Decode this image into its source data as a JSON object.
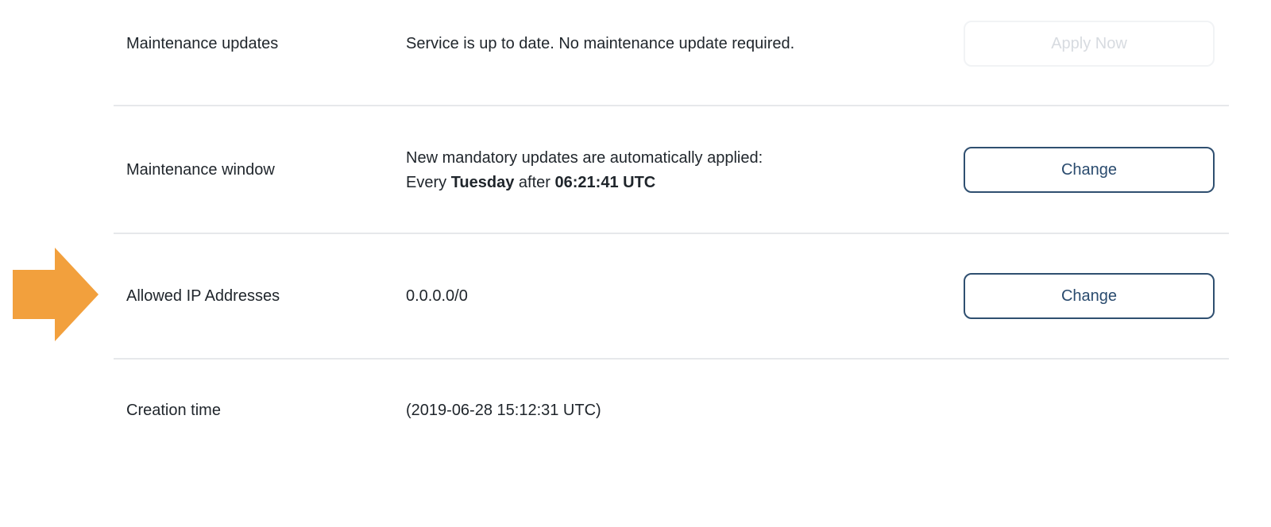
{
  "settings": {
    "maintenance_updates": {
      "label": "Maintenance updates",
      "value": "Service is up to date. No maintenance update required.",
      "button_label": "Apply Now",
      "button_enabled": false
    },
    "maintenance_window": {
      "label": "Maintenance window",
      "value_line1": "New mandatory updates are automatically applied:",
      "value_every": "Every",
      "value_day": "Tuesday",
      "value_after": "after",
      "value_time": "06:21:41 UTC",
      "button_label": "Change"
    },
    "allowed_ip": {
      "label": "Allowed IP Addresses",
      "value": "0.0.0.0/0",
      "button_label": "Change"
    },
    "creation_time": {
      "label": "Creation time",
      "value": "(2019-06-28 15:12:31 UTC)"
    }
  },
  "annotation": {
    "arrow_icon": "right-arrow-icon",
    "arrow_color": "#f2a03d"
  },
  "colors": {
    "button_border": "#2f4f70",
    "button_text": "#2a4b6e",
    "divider": "#e6e8eb"
  }
}
